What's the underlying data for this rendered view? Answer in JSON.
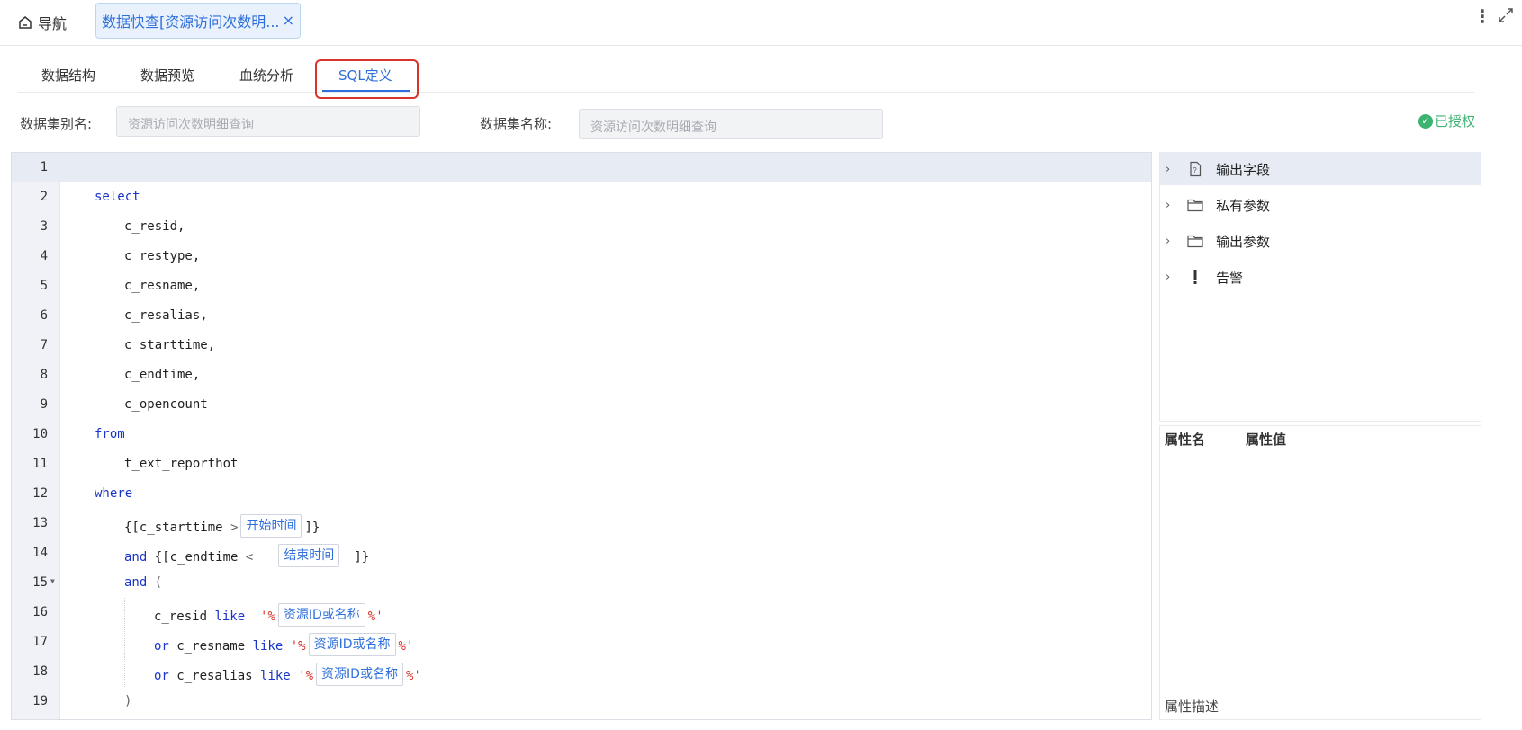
{
  "topbar": {
    "home_label": "导航",
    "tab_label": "数据快查[资源访问次数明...",
    "tab_close": "×"
  },
  "subtabs": [
    "数据结构",
    "数据预览",
    "血统分析",
    "SQL定义"
  ],
  "active_subtab": "SQL定义",
  "fields": {
    "alias_label": "数据集别名:",
    "alias_value": "资源访问次数明细查询",
    "name_label": "数据集名称:",
    "name_value": "资源访问次数明细查询"
  },
  "auth_status": "已授权",
  "editor": {
    "line_numbers": [
      "1",
      "2",
      "3",
      "4",
      "5",
      "6",
      "7",
      "8",
      "9",
      "10",
      "11",
      "12",
      "13",
      "14",
      "15",
      "16",
      "17",
      "18",
      "19"
    ],
    "tokens": {
      "select": "select",
      "c_resid": "c_resid,",
      "c_restype": "c_restype,",
      "c_resname": "c_resname,",
      "c_resalias": "c_resalias,",
      "c_starttime": "c_starttime,",
      "c_endtime": "c_endtime,",
      "c_opencount": "c_opencount",
      "from": "from",
      "table": "t_ext_reporthot",
      "where": "where",
      "l13_a": "{[c_starttime ",
      "l13_op": ">",
      "l13_param": "开始时间",
      "l13_b": "]}",
      "and": "and",
      "l14_a": " {[c_endtime ",
      "l14_op": "<",
      "l14_param": "结束时间",
      "l14_b": "]}",
      "l15_b": " (",
      "l16_a": "c_resid ",
      "like": "like",
      "q_open": "'%",
      "q_close": "%'",
      "param_res": "资源ID或名称",
      "or": "or",
      "l17_a": " c_resname ",
      "l18_a": " c_resalias ",
      "l19": ")"
    }
  },
  "tree": [
    "输出字段",
    "私有参数",
    "输出参数",
    "告警"
  ],
  "props": {
    "col_name": "属性名",
    "col_value": "属性值",
    "desc": "属性描述"
  }
}
